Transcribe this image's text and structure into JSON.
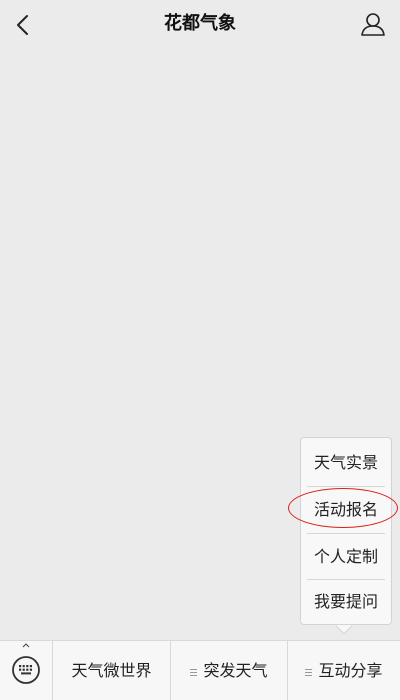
{
  "header": {
    "title": "花都气象",
    "back_icon": "chevron-left-icon",
    "profile_icon": "user-icon"
  },
  "popup_menu": {
    "items": [
      {
        "label": "天气实景"
      },
      {
        "label": "活动报名",
        "highlighted": true
      },
      {
        "label": "个人定制"
      },
      {
        "label": "我要提问"
      }
    ],
    "highlight_color": "#d9201c"
  },
  "bottom_bar": {
    "keyboard_icon": "keyboard-icon",
    "tabs": [
      {
        "label": "天气微世界",
        "has_submenu": false
      },
      {
        "label": "突发天气",
        "has_submenu": true
      },
      {
        "label": "互动分享",
        "has_submenu": true,
        "open": true
      }
    ]
  }
}
